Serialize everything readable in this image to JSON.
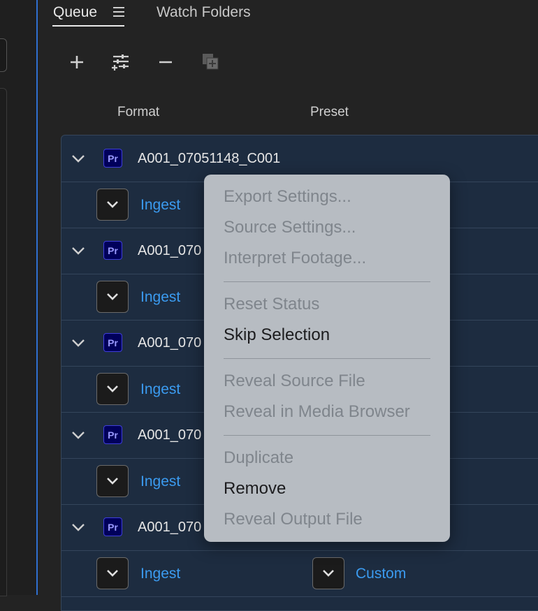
{
  "tabs": {
    "queue": "Queue",
    "watch_folders": "Watch Folders"
  },
  "toolbar": {
    "add_icon": "plus-icon",
    "settings_icon": "preset-settings-icon",
    "remove_icon": "minus-icon",
    "duplicate_icon": "duplicate-icon"
  },
  "columns": {
    "format": "Format",
    "preset": "Preset"
  },
  "queue": {
    "sources": [
      {
        "name": "A001_07051148_C001",
        "output_format": "Ingest"
      },
      {
        "name": "A001_070",
        "output_format": "Ingest"
      },
      {
        "name": "A001_070",
        "output_format": "Ingest"
      },
      {
        "name": "A001_070",
        "output_format": "Ingest"
      },
      {
        "name": "A001_070",
        "output_format": "Ingest",
        "output_preset": "Custom"
      }
    ],
    "app_badge": "Pr"
  },
  "context_menu": {
    "items": [
      {
        "label": "Export Settings...",
        "enabled": false
      },
      {
        "label": "Source Settings...",
        "enabled": false
      },
      {
        "label": "Interpret Footage...",
        "enabled": false
      },
      {
        "label": "Reset Status",
        "enabled": false
      },
      {
        "label": "Skip Selection",
        "enabled": true
      },
      {
        "label": "Reveal Source File",
        "enabled": false
      },
      {
        "label": "Reveal in Media Browser",
        "enabled": false
      },
      {
        "label": "Duplicate",
        "enabled": false
      },
      {
        "label": "Remove",
        "enabled": true
      },
      {
        "label": "Reveal Output File",
        "enabled": false
      }
    ]
  },
  "colors": {
    "accent_link": "#3b9bf0",
    "queue_bg": "#1d2c40",
    "menu_bg": "#b7bcc2",
    "tab_divider": "#2f6fcf"
  }
}
